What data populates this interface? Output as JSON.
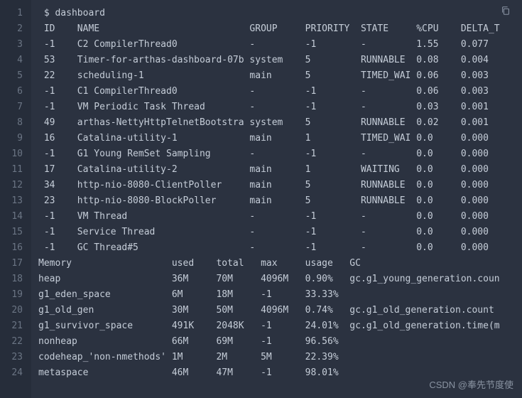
{
  "command": "$ dashboard",
  "threads": {
    "headers": {
      "id": "ID",
      "name": "NAME",
      "group": "GROUP",
      "priority": "PRIORITY",
      "state": "STATE",
      "cpu": "%CPU",
      "delta": "DELTA_T"
    },
    "rows": [
      {
        "id": "-1",
        "name": "C2 CompilerThread0",
        "group": "-",
        "priority": "-1",
        "state": "-",
        "cpu": "1.55",
        "delta": "0.077"
      },
      {
        "id": "53",
        "name": "Timer-for-arthas-dashboard-07b",
        "group": "system",
        "priority": "5",
        "state": "RUNNABLE",
        "cpu": "0.08",
        "delta": "0.004"
      },
      {
        "id": "22",
        "name": "scheduling-1",
        "group": "main",
        "priority": "5",
        "state": "TIMED_WAI",
        "cpu": "0.06",
        "delta": "0.003"
      },
      {
        "id": "-1",
        "name": "C1 CompilerThread0",
        "group": "-",
        "priority": "-1",
        "state": "-",
        "cpu": "0.06",
        "delta": "0.003"
      },
      {
        "id": "-1",
        "name": "VM Periodic Task Thread",
        "group": "-",
        "priority": "-1",
        "state": "-",
        "cpu": "0.03",
        "delta": "0.001"
      },
      {
        "id": "49",
        "name": "arthas-NettyHttpTelnetBootstra",
        "group": "system",
        "priority": "5",
        "state": "RUNNABLE",
        "cpu": "0.02",
        "delta": "0.001"
      },
      {
        "id": "16",
        "name": "Catalina-utility-1",
        "group": "main",
        "priority": "1",
        "state": "TIMED_WAI",
        "cpu": "0.0",
        "delta": "0.000"
      },
      {
        "id": "-1",
        "name": "G1 Young RemSet Sampling",
        "group": "-",
        "priority": "-1",
        "state": "-",
        "cpu": "0.0",
        "delta": "0.000"
      },
      {
        "id": "17",
        "name": "Catalina-utility-2",
        "group": "main",
        "priority": "1",
        "state": "WAITING",
        "cpu": "0.0",
        "delta": "0.000"
      },
      {
        "id": "34",
        "name": "http-nio-8080-ClientPoller",
        "group": "main",
        "priority": "5",
        "state": "RUNNABLE",
        "cpu": "0.0",
        "delta": "0.000"
      },
      {
        "id": "23",
        "name": "http-nio-8080-BlockPoller",
        "group": "main",
        "priority": "5",
        "state": "RUNNABLE",
        "cpu": "0.0",
        "delta": "0.000"
      },
      {
        "id": "-1",
        "name": "VM Thread",
        "group": "-",
        "priority": "-1",
        "state": "-",
        "cpu": "0.0",
        "delta": "0.000"
      },
      {
        "id": "-1",
        "name": "Service Thread",
        "group": "-",
        "priority": "-1",
        "state": "-",
        "cpu": "0.0",
        "delta": "0.000"
      },
      {
        "id": "-1",
        "name": "GC Thread#5",
        "group": "-",
        "priority": "-1",
        "state": "-",
        "cpu": "0.0",
        "delta": "0.000"
      }
    ]
  },
  "memory": {
    "headers": {
      "label": "Memory",
      "used": "used",
      "total": "total",
      "max": "max",
      "usage": "usage",
      "gc": "GC"
    },
    "rows": [
      {
        "label": "heap",
        "used": "36M",
        "total": "70M",
        "max": "4096M",
        "usage": "0.90%",
        "gc": "gc.g1_young_generation.coun"
      },
      {
        "label": "g1_eden_space",
        "used": "6M",
        "total": "18M",
        "max": "-1",
        "usage": "33.33%",
        "gc": ""
      },
      {
        "label": "g1_old_gen",
        "used": "30M",
        "total": "50M",
        "max": "4096M",
        "usage": "0.74%",
        "gc": "gc.g1_old_generation.count"
      },
      {
        "label": "g1_survivor_space",
        "used": "491K",
        "total": "2048K",
        "max": "-1",
        "usage": "24.01%",
        "gc": "gc.g1_old_generation.time(m"
      },
      {
        "label": "nonheap",
        "used": "66M",
        "total": "69M",
        "max": "-1",
        "usage": "96.56%",
        "gc": ""
      },
      {
        "label": "codeheap_'non-nmethods'",
        "used": "1M",
        "total": "2M",
        "max": "5M",
        "usage": "22.39%",
        "gc": ""
      },
      {
        "label": "metaspace",
        "used": "46M",
        "total": "47M",
        "max": "-1",
        "usage": "98.01%",
        "gc": ""
      }
    ]
  },
  "watermark": "CSDN @奉先节度使",
  "line_count": 24
}
